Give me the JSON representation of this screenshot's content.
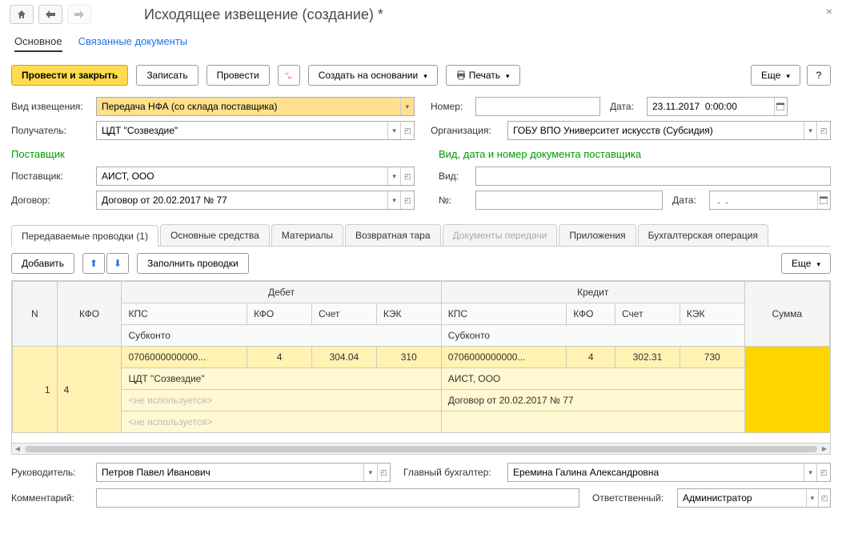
{
  "top": {
    "title": "Исходящее извещение (создание) *",
    "close": "×"
  },
  "nav": {
    "main": "Основное",
    "linked": "Связанные документы"
  },
  "toolbar": {
    "post_close": "Провести и закрыть",
    "save": "Записать",
    "post": "Провести",
    "create_based": "Создать на основании",
    "print": "Печать",
    "more": "Еще",
    "help": "?"
  },
  "fields": {
    "notif_type_lbl": "Вид извещения:",
    "notif_type_val": "Передача НФА (со склада поставщика)",
    "number_lbl": "Номер:",
    "number_val": "",
    "date_lbl": "Дата:",
    "date_val": "23.11.2017  0:00:00",
    "recipient_lbl": "Получатель:",
    "recipient_val": "ЦДТ \"Созвездие\"",
    "org_lbl": "Организация:",
    "org_val": "ГОБУ ВПО Университет искусств (Субсидия)"
  },
  "supplier": {
    "title": "Поставщик",
    "supplier_lbl": "Поставщик:",
    "supplier_val": "АИСТ, ООО",
    "contract_lbl": "Договор:",
    "contract_val": "Договор от 20.02.2017 № 77"
  },
  "supplier_doc": {
    "title": "Вид, дата и номер документа поставщика",
    "type_lbl": "Вид:",
    "type_val": "",
    "num_lbl": "№:",
    "num_val": "",
    "date_lbl": "Дата:",
    "date_val": " .  ."
  },
  "tabs2": {
    "t0": "Передаваемые проводки (1)",
    "t1": "Основные средства",
    "t2": "Материалы",
    "t3": "Возвратная тара",
    "t4": "Документы передачи",
    "t5": "Приложения",
    "t6": "Бухгалтерская операция"
  },
  "grid_toolbar": {
    "add": "Добавить",
    "fill": "Заполнить проводки",
    "more": "Еще"
  },
  "grid": {
    "headers": {
      "n": "N",
      "kfo": "КФО",
      "debit": "Дебет",
      "credit": "Кредит",
      "sum": "Сумма",
      "kps": "КПС",
      "kfo2": "КФО",
      "acct": "Счет",
      "kek": "КЭК",
      "sub": "Субконто"
    },
    "row": {
      "n": "1",
      "kfo": "4",
      "d_kps": "0706000000000...",
      "d_kfo": "4",
      "d_acct": "304.04",
      "d_kek": "310",
      "c_kps": "0706000000000...",
      "c_kfo": "4",
      "c_acct": "302.31",
      "c_kek": "730",
      "d_sub1": "ЦДТ \"Созвездие\"",
      "c_sub1": "АИСТ, ООО",
      "d_sub2": "<не используется>",
      "c_sub2": "Договор от 20.02.2017 № 77",
      "d_sub3": "<не используется>"
    }
  },
  "chart_data": {
    "type": "table",
    "rows": [
      {
        "N": 1,
        "КФО": 4,
        "Дебет": {
          "КПС": "0706000000000...",
          "КФО": 4,
          "Счет": "304.04",
          "КЭК": 310,
          "Субконто": [
            "ЦДТ \"Созвездие\"",
            "<не используется>",
            "<не используется>"
          ]
        },
        "Кредит": {
          "КПС": "0706000000000...",
          "КФО": 4,
          "Счет": "302.31",
          "КЭК": 730,
          "Субконто": [
            "АИСТ, ООО",
            "Договор от 20.02.2017 № 77"
          ]
        },
        "Сумма": null
      }
    ]
  },
  "footer": {
    "manager_lbl": "Руководитель:",
    "manager_val": "Петров Павел Иванович",
    "chief_acc_lbl": "Главный бухгалтер:",
    "chief_acc_val": "Еремина Галина Александровна",
    "comment_lbl": "Комментарий:",
    "comment_val": "",
    "responsible_lbl": "Ответственный:",
    "responsible_val": "Администратор"
  }
}
